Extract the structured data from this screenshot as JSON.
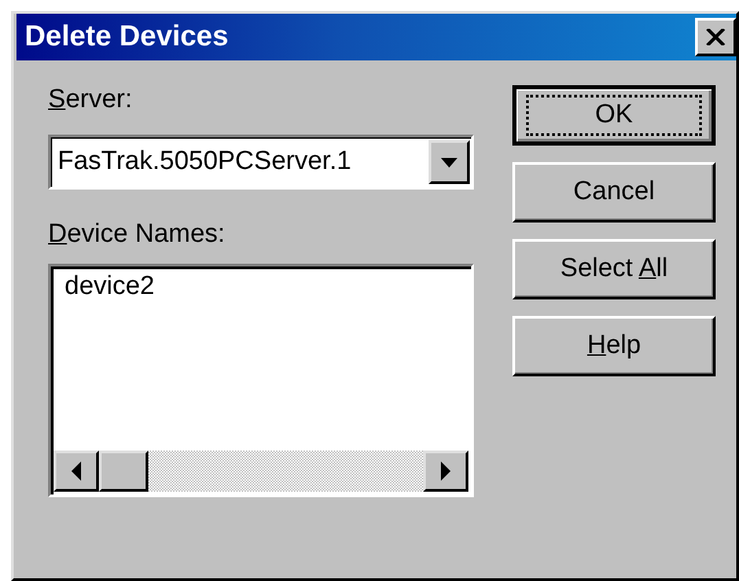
{
  "window": {
    "title": "Delete Devices"
  },
  "server": {
    "label": [
      {
        "text": "S",
        "underlined": true
      },
      {
        "text": "erver:",
        "underlined": false
      }
    ],
    "value": "FasTrak.5050PCServer.1"
  },
  "devices": {
    "label": [
      {
        "text": "D",
        "underlined": true
      },
      {
        "text": "evice Names:",
        "underlined": false
      }
    ],
    "items": [
      {
        "name": "device2",
        "selected": false
      }
    ]
  },
  "buttons": [
    {
      "label": [
        {
          "text": "OK",
          "underlined": false
        }
      ],
      "default": true
    },
    {
      "label": [
        {
          "text": "Cancel",
          "underlined": false
        }
      ],
      "default": false
    },
    {
      "label": [
        {
          "text": "Select ",
          "underlined": false
        },
        {
          "text": "A",
          "underlined": true
        },
        {
          "text": "ll",
          "underlined": false
        }
      ],
      "default": false
    },
    {
      "label": [
        {
          "text": "H",
          "underlined": true
        },
        {
          "text": "elp",
          "underlined": false
        }
      ],
      "default": false
    }
  ]
}
